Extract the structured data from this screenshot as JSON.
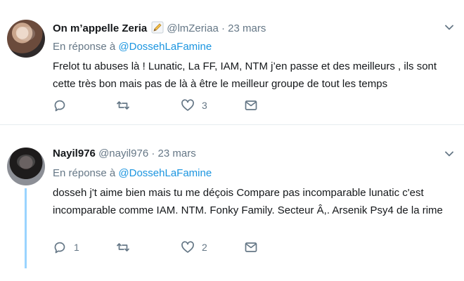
{
  "tweets": [
    {
      "name": "On m’appelle Zeria",
      "handle": "@lmZeriaa",
      "dot": "·",
      "date": "23 mars",
      "reply_prefix": "En réponse à",
      "reply_to": "@DossehLaFamine",
      "text": "Frelot tu abuses là ! Lunatic, La FF, IAM, NTM j’en passe et des meilleurs , ils sont cette très bon mais pas de là à être le meilleur groupe de tout les temps",
      "reply_count": "",
      "like_count": "3"
    },
    {
      "name": "Nayil976",
      "handle": "@nayil976",
      "dot": "·",
      "date": "23 mars",
      "reply_prefix": "En réponse à",
      "reply_to": "@DossehLaFamine",
      "text": "dosseh j't aime bien mais tu me déçois Compare pas incomparable lunatic c'est incomparable comme IAM. NTM. Fonky Family. Secteur Â,. Arsenik Psy4 de la rime",
      "reply_count": "1",
      "like_count": "2"
    }
  ],
  "icons": {
    "reply": "reply-bubble-icon",
    "retweet": "retweet-icon",
    "like": "heart-icon",
    "dm": "envelope-icon",
    "menu": "chevron-down-icon",
    "badge": "pencil-emoji-icon"
  },
  "colors": {
    "link": "#1b95e0",
    "secondary": "#657786",
    "text": "#14171a",
    "thread": "#9ad4ff"
  }
}
